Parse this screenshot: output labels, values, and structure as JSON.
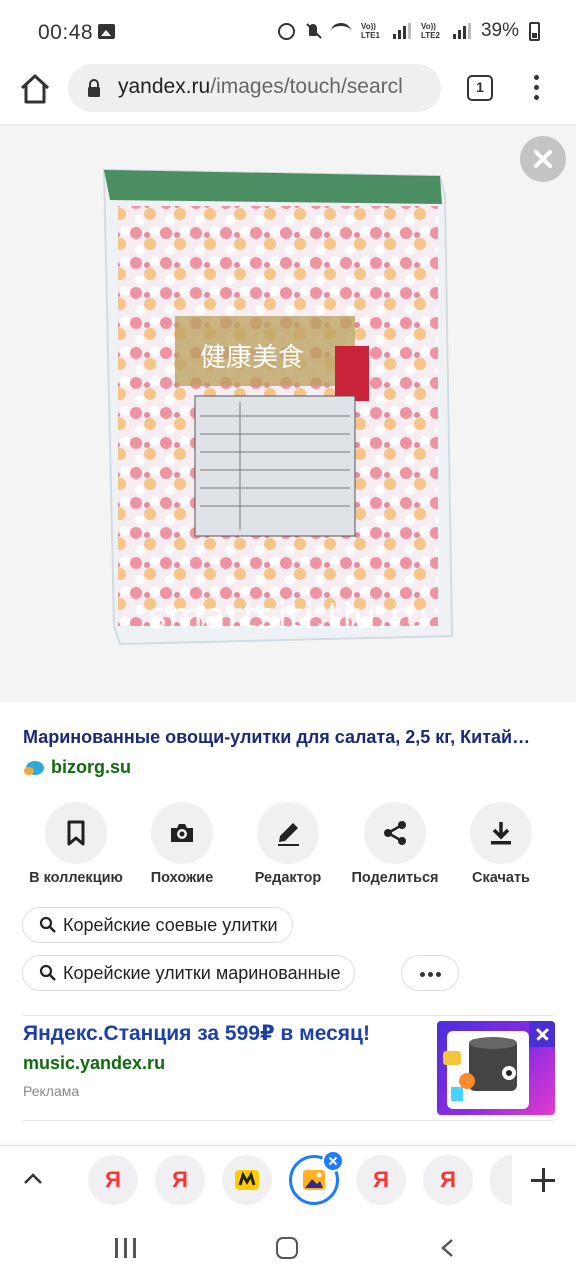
{
  "status_bar": {
    "time": "00:48",
    "lte1": "Vo)) LTE1",
    "lte2": "Vo)) LTE2",
    "battery": "39%"
  },
  "browser": {
    "url_domain": "yandex.ru",
    "url_path": "/images/touch/searcl",
    "tab_count": "1"
  },
  "image": {
    "watermark": "smartsiti.tiu.ru",
    "package_text": "健康美食"
  },
  "result": {
    "title": "Маринованные овощи-улитки для салата, 2,5 кг, Китай…",
    "source": "bizorg.su"
  },
  "actions": [
    {
      "label": "В коллекцию",
      "icon": "bookmark-icon"
    },
    {
      "label": "Похожие",
      "icon": "camera-search-icon"
    },
    {
      "label": "Редактор",
      "icon": "pencil-icon"
    },
    {
      "label": "Поделиться",
      "icon": "share-icon"
    },
    {
      "label": "Скачать",
      "icon": "download-icon"
    }
  ],
  "related_searches": [
    "Корейские соевые улитки",
    "Корейские улитки маринованные"
  ],
  "ad": {
    "title": "Яндекс.Станция за 599₽ в месяц!",
    "link": "music.yandex.ru",
    "label": "Реклама"
  },
  "tabs": {
    "yandex_letter": "Я"
  },
  "colors": {
    "title_link": "#1a2877",
    "source_green": "#0e6b0e",
    "ad_blue": "#1c3fa8",
    "active_tab": "#1f7bff",
    "yandex_red": "#ff3333"
  }
}
